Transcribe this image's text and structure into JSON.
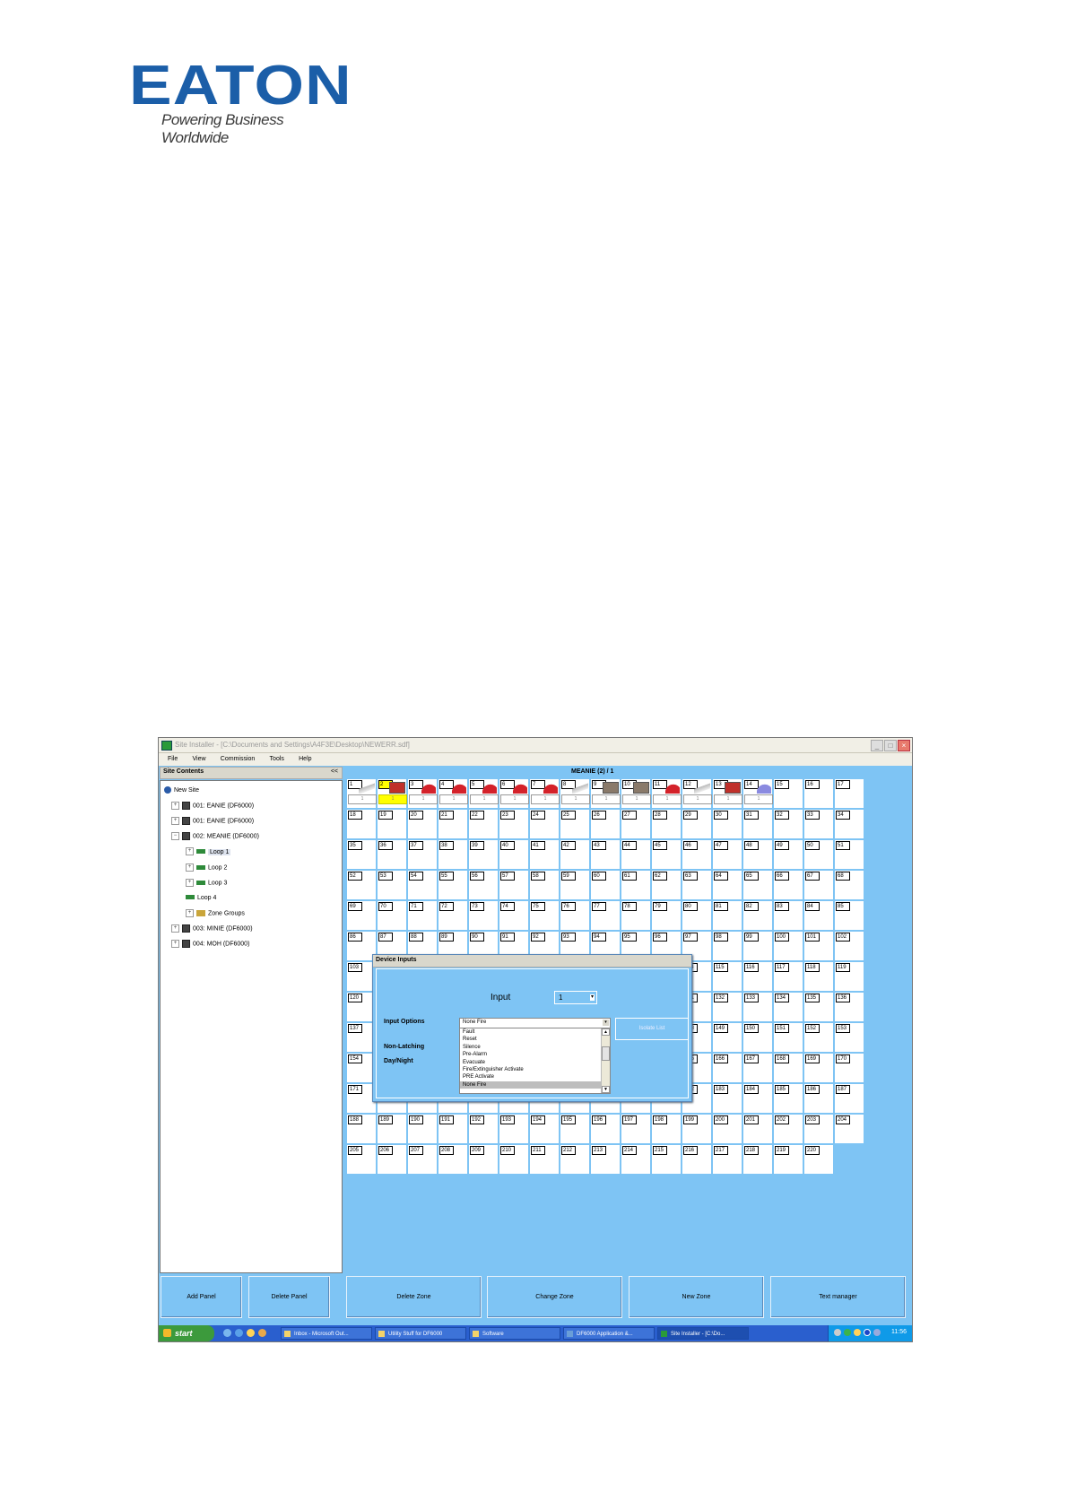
{
  "brand": {
    "logo_text": "EATON",
    "tagline": "Powering Business Worldwide"
  },
  "window": {
    "title": "Site Installer - [C:\\Documents and Settings\\A4F3E\\Desktop\\NEWERR.sdf]",
    "controls": [
      "_",
      "□",
      "×"
    ]
  },
  "menu": [
    "File",
    "View",
    "Commission",
    "Tools",
    "Help"
  ],
  "site_contents": {
    "title": "Site Contents",
    "collapse": "<<",
    "tree": [
      {
        "label": "New Site",
        "icon": "site-icon"
      },
      {
        "label": "001: EANIE (DF6000)",
        "icon": "panel-icon"
      },
      {
        "label": "001: EANIE (DF6000)",
        "icon": "panel-icon"
      },
      {
        "label": "002: MEANIE (DF6000)",
        "icon": "panel-icon"
      },
      {
        "label": "Loop 1",
        "icon": "loop-icon",
        "selected": true
      },
      {
        "label": "Loop 2",
        "icon": "loop-icon"
      },
      {
        "label": "Loop 3",
        "icon": "loop-icon"
      },
      {
        "label": "Loop 4",
        "icon": "loop-icon"
      },
      {
        "label": "Zone Groups",
        "icon": "zone-groups-icon"
      },
      {
        "label": "003: MINIE (DF6000)",
        "icon": "panel-icon"
      },
      {
        "label": "004: MOH (DF6000)",
        "icon": "panel-icon"
      }
    ]
  },
  "grid": {
    "title": "MEANIE (2) / 1",
    "addresses_total": 220,
    "highlighted_address": "2",
    "devices": {
      "1": "smoke-detector",
      "2": "panel-device",
      "3": "sounder",
      "4": "sounder",
      "5": "sounder",
      "6": "sounder",
      "7": "sounder",
      "8": "smoke-detector",
      "9": "io-module",
      "10": "io-module",
      "11": "sounder",
      "12": "smoke-detector",
      "13": "panel-device",
      "14": "beacon"
    },
    "sub_value": "1"
  },
  "dialog": {
    "title": "Device Inputs",
    "input_label": "Input",
    "input_value": "1",
    "input_options_label": "Input Options",
    "non_latching_label": "Non-Latching",
    "day_night_label": "Day/Night",
    "selected_option": "None Fire",
    "options": [
      "Fault",
      "Reset",
      "Silence",
      "Pre-Alarm",
      "Evacuate",
      "Fire/Extinguisher Activate",
      "PRE Activate",
      "None Fire"
    ],
    "isolate_button": "Isolate List"
  },
  "buttons": [
    "Add Panel",
    "Delete Panel",
    "Delete Zone",
    "Change Zone",
    "New Zone",
    "Text manager"
  ],
  "taskbar": {
    "start": "start",
    "items": [
      {
        "label": "Inbox - Microsoft Out...",
        "active": false
      },
      {
        "label": "Utility Stuff for DF6000",
        "active": false
      },
      {
        "label": "Software",
        "active": false
      },
      {
        "label": "DF6000 Application &...",
        "active": false
      },
      {
        "label": "Site Installer - [C:\\Do...",
        "active": true
      }
    ],
    "clock": "11:56"
  },
  "colors": {
    "app_bg": "#7ec4f4",
    "highlight": "#ffff00",
    "brand": "#1b5ea8"
  }
}
